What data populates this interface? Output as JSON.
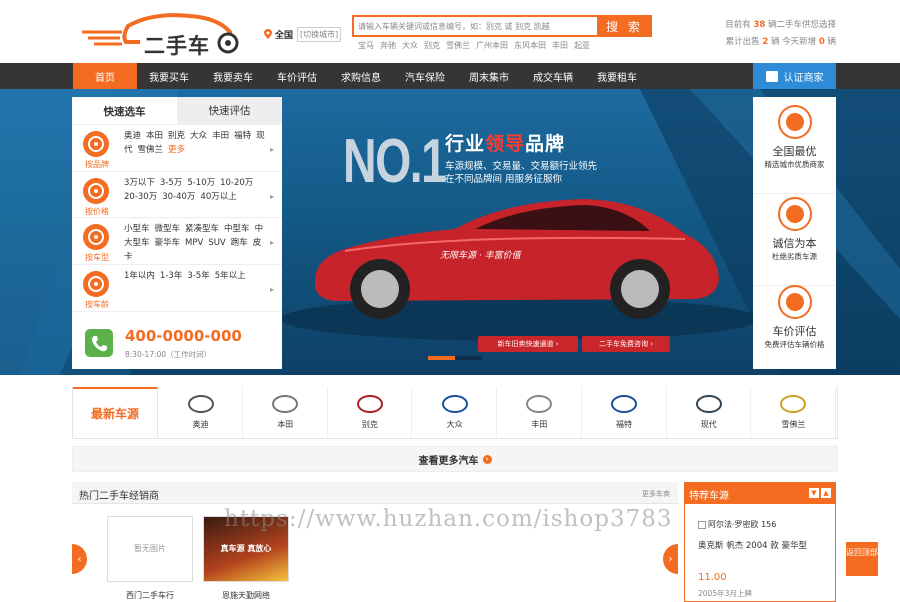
{
  "header": {
    "logo_text": "二手车",
    "city": {
      "name": "全国",
      "switch_label": "[切换城市]"
    },
    "search": {
      "placeholder": "请输入车辆关键词或信息编号，如：别克 或 别克 凯越",
      "button": "搜 索"
    },
    "hot_tags": [
      "宝马",
      "奔驰",
      "大众",
      "别克",
      "雪佛兰",
      "广州本田",
      "东风本田",
      "丰田",
      "起亚"
    ],
    "stats": {
      "line1_prefix": "目前有",
      "line1_count": "38",
      "line1_suffix": "辆二手车供您选择",
      "line2_prefix": "累计出售",
      "line2_sold": "2",
      "line2_mid": "辆 今天新增",
      "line2_today": "0",
      "line2_suffix": "辆"
    }
  },
  "nav": {
    "items": [
      "首页",
      "我要买车",
      "我要卖车",
      "车价评估",
      "求购信息",
      "汽车保险",
      "周末集市",
      "成交车辆",
      "我要租车"
    ],
    "active_index": 0,
    "cert_label": "认证商家"
  },
  "banner": {
    "no1": "NO.1",
    "title_a": "行业",
    "title_b": "领导",
    "title_c": "品牌",
    "sub1": "车源规模、交易量、交易额行业领先",
    "sub2": "在不同品牌间 用服务征服你",
    "car_slogan": "无限车源 · 丰富价值",
    "pill1": "新车旧卖快速通道",
    "pill2": "二手车免费咨询",
    "slide_count": 2,
    "active_slide": 0
  },
  "left_panel": {
    "tabs": [
      "快速选车",
      "快速评估"
    ],
    "active_tab": 0,
    "rows": [
      {
        "label": "按品牌",
        "icon": "steering-wheel-icon",
        "links": [
          "奥迪",
          "本田",
          "别克",
          "大众",
          "丰田",
          "福特",
          "现代",
          "雪佛兰"
        ],
        "more": "更多"
      },
      {
        "label": "按价格",
        "icon": "yen-icon",
        "links": [
          "3万以下",
          "3-5万",
          "5-10万",
          "10-20万",
          "20-30万",
          "30-40万",
          "40万以上"
        ],
        "more": ""
      },
      {
        "label": "按车型",
        "icon": "car-icon",
        "links": [
          "小型车",
          "微型车",
          "紧凑型车",
          "中型车",
          "中大型车",
          "豪华车",
          "MPV",
          "SUV",
          "跑车",
          "皮卡"
        ],
        "more": ""
      },
      {
        "label": "按车龄",
        "icon": "clock-icon",
        "links": [
          "1年以内",
          "1-3年",
          "3-5年",
          "5年以上"
        ],
        "more": ""
      }
    ],
    "hotline": {
      "number": "400-0000-000",
      "hours": "8:30-17:00（工作时间）"
    }
  },
  "right_panel": [
    {
      "title": "全国最优",
      "sub": "精选城市优质商家",
      "icon": "china-map-icon"
    },
    {
      "title": "诚信为本",
      "sub": "杜绝劣质车源",
      "icon": "handshake-icon"
    },
    {
      "title": "车价评估",
      "sub": "免费评估车辆价格",
      "icon": "yen-icon"
    }
  ],
  "brands": {
    "title": "最新车源",
    "items": [
      {
        "name": "奥迪",
        "icon": "audi-logo-icon"
      },
      {
        "name": "本田",
        "icon": "honda-logo-icon"
      },
      {
        "name": "别克",
        "icon": "buick-logo-icon"
      },
      {
        "name": "大众",
        "icon": "vw-logo-icon"
      },
      {
        "name": "丰田",
        "icon": "toyota-logo-icon"
      },
      {
        "name": "福特",
        "icon": "ford-logo-icon"
      },
      {
        "name": "现代",
        "icon": "hyundai-logo-icon"
      },
      {
        "name": "雪佛兰",
        "icon": "chevrolet-logo-icon"
      }
    ],
    "more_label": "查看更多汽车"
  },
  "dealers": {
    "title": "热门二手车经销商",
    "more": "更多车商",
    "cards": [
      {
        "name": "西门二手车行",
        "image_text": "暂无图片"
      },
      {
        "name": "恩施天勤网络",
        "image_text": "真车源 真放心"
      }
    ]
  },
  "recommend": {
    "title": "特荐车源",
    "check_label": "阿尔法·罗密欧 156",
    "car": "奥克斯 帆杰 2004 款 豪华型",
    "price": "11.00",
    "date": "2005年3月上牌"
  },
  "back_top": "返回顶部",
  "watermark": "https://www.huzhan.com/ishop3783",
  "colors": {
    "accent": "#f36c21",
    "nav_bg": "#353535",
    "cert_blue": "#2d8bd8",
    "banner_dark": "#0e4067"
  }
}
